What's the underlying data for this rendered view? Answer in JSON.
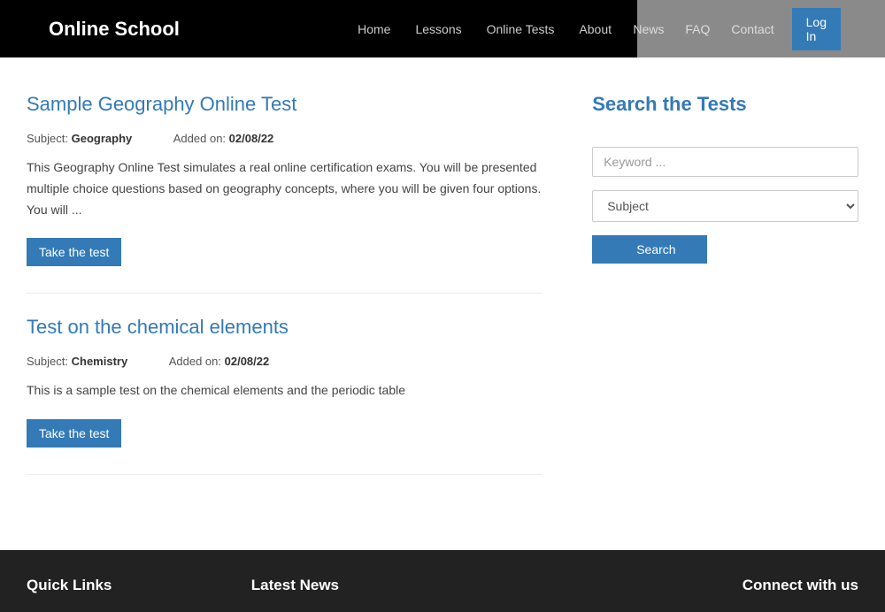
{
  "brand": "Online School",
  "nav": {
    "home": "Home",
    "lessons": "Lessons",
    "online_tests": "Online Tests",
    "about": "About",
    "news": "News",
    "faq": "FAQ",
    "contact": "Contact",
    "login": "Log In"
  },
  "tests": [
    {
      "title": "Sample Geography Online Test",
      "subject_label": "Subject:",
      "subject": "Geography",
      "added_label": "Added on:",
      "added": "02/08/22",
      "desc": "This Geography Online Test simulates a real online certification exams. You will be presented multiple choice questions based on geography concepts, where you will be given four options. You will ...",
      "button": "Take the test"
    },
    {
      "title": "Test on the chemical elements",
      "subject_label": "Subject:",
      "subject": "Chemistry",
      "added_label": "Added on:",
      "added": "02/08/22",
      "desc": "This is a sample test on the chemical elements and the periodic table",
      "button": "Take the test"
    }
  ],
  "sidebar": {
    "heading": "Search the Tests",
    "keyword_placeholder": "Keyword ...",
    "subject_default": "Subject",
    "search_button": "Search"
  },
  "footer": {
    "quick_links": "Quick Links",
    "latest_news": "Latest News",
    "connect": "Connect with us"
  }
}
